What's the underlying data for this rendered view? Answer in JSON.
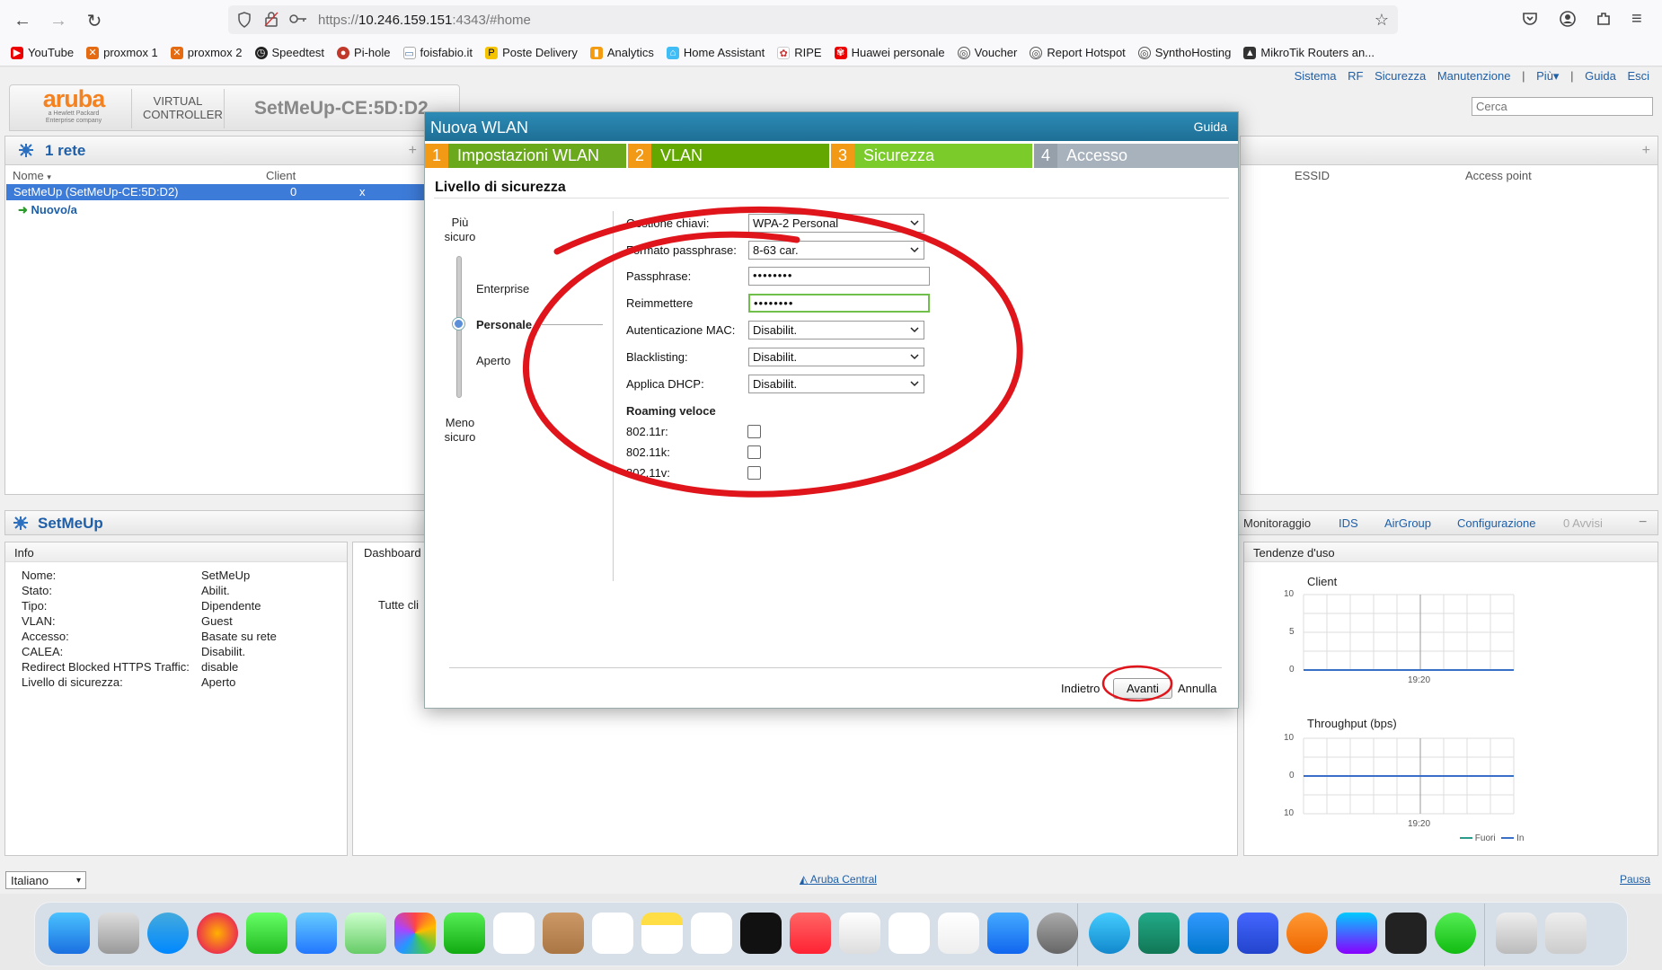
{
  "browser": {
    "url_prefix": "https://",
    "url_host": "10.246.159.151",
    "url_suffix": ":4343/#home",
    "bookmarks": [
      "YouTube",
      "proxmox 1",
      "proxmox 2",
      "Speedtest",
      "Pi-hole",
      "foisfabio.it",
      "Poste Delivery",
      "Analytics",
      "Home Assistant",
      "RIPE",
      "Huawei personale",
      "Voucher",
      "Report Hotspot",
      "SynthoHosting",
      "MikroTik Routers an..."
    ]
  },
  "app": {
    "logo": "aruba",
    "logo_sub": "a Hewlett Packard Enterprise company",
    "product_line1": "VIRTUAL",
    "product_line2": "CONTROLLER",
    "controller_name": "SetMeUp-CE:5D:D2",
    "top_links": [
      "Sistema",
      "RF",
      "Sicurezza",
      "Manutenzione",
      "|",
      "Più▾",
      "|",
      "Guida",
      "Esci"
    ],
    "search_placeholder": "Cerca",
    "networks": {
      "title": "1 rete",
      "plus": "+",
      "col_name": "Nome",
      "col_client": "Client",
      "row_name": "SetMeUp (SetMeUp-CE:5D:D2)",
      "row_client": "0",
      "row_close": "x",
      "new_label": "Nuovo/a"
    },
    "right_cols": {
      "essid": "ESSID",
      "ap": "Access point",
      "plus": "+"
    },
    "setmeup": {
      "title": "SetMeUp",
      "info_title": "Info",
      "rows": [
        {
          "k": "Nome:",
          "v": "SetMeUp"
        },
        {
          "k": "Stato:",
          "v": "Abilit."
        },
        {
          "k": "Tipo:",
          "v": "Dipendente"
        },
        {
          "k": "VLAN:",
          "v": "Guest"
        },
        {
          "k": "Accesso:",
          "v": "Basate su rete"
        },
        {
          "k": "CALEA:",
          "v": "Disabilit."
        },
        {
          "k": "Redirect Blocked HTTPS Traffic:",
          "v": "disable"
        },
        {
          "k": "Livello di sicurezza:",
          "v": "Aperto"
        }
      ],
      "dashboard_title": "Dashboard",
      "all_clients": "Tutte cli"
    },
    "monitor_tabs": [
      "Monitoraggio",
      "IDS",
      "AirGroup",
      "Configurazione"
    ],
    "alerts": "0 Avvisi",
    "minus": "−",
    "trends": {
      "title": "Tendenze d'uso",
      "client_title": "Client",
      "client_ticks": [
        "10",
        "5",
        "0"
      ],
      "time": "19:20",
      "throughput_title": "Throughput  (bps)",
      "tp_ticks": [
        "10",
        "0",
        "10"
      ],
      "legend_out": "Fuori",
      "legend_in": "In"
    },
    "language": "Italiano",
    "aruba_central": "Aruba Central",
    "pause": "Pausa"
  },
  "modal": {
    "title": "Nuova WLAN",
    "help": "Guida",
    "steps": [
      {
        "n": "1",
        "label": "Impostazioni WLAN"
      },
      {
        "n": "2",
        "label": "VLAN"
      },
      {
        "n": "3",
        "label": "Sicurezza"
      },
      {
        "n": "4",
        "label": "Accesso"
      }
    ],
    "section_title": "Livello di sicurezza",
    "slider": {
      "top": "Più sicuro",
      "l1": "Enterprise",
      "l2": "Personale",
      "l3": "Aperto",
      "bottom": "Meno sicuro"
    },
    "fields": {
      "key_mgmt_label": "Gestione chiavi:",
      "key_mgmt_value": "WPA-2 Personal",
      "pass_format_label": "Formato passphrase:",
      "pass_format_value": "8-63 car.",
      "pass_label": "Passphrase:",
      "pass_value": "••••••••",
      "reenter_label": "Reimmettere",
      "reenter_value": "••••••••",
      "mac_label": "Autenticazione MAC:",
      "mac_value": "Disabilit.",
      "blacklist_label": "Blacklisting:",
      "blacklist_value": "Disabilit.",
      "dhcp_label": "Applica DHCP:",
      "dhcp_value": "Disabilit.",
      "roaming_title": "Roaming veloce",
      "r_label": "802.11r:",
      "k_label": "802.11k:",
      "v_label": "802.11v:"
    },
    "buttons": {
      "back": "Indietro",
      "next": "Avanti",
      "cancel": "Annulla"
    }
  },
  "colors": {
    "annotation": "#e0141b",
    "accent": "#1f5fa7",
    "step1": "#7cb518",
    "step2": "#5fa800",
    "step3": "#7ccb2a",
    "step4": "#a9b3bd",
    "num": "#f29a16"
  }
}
